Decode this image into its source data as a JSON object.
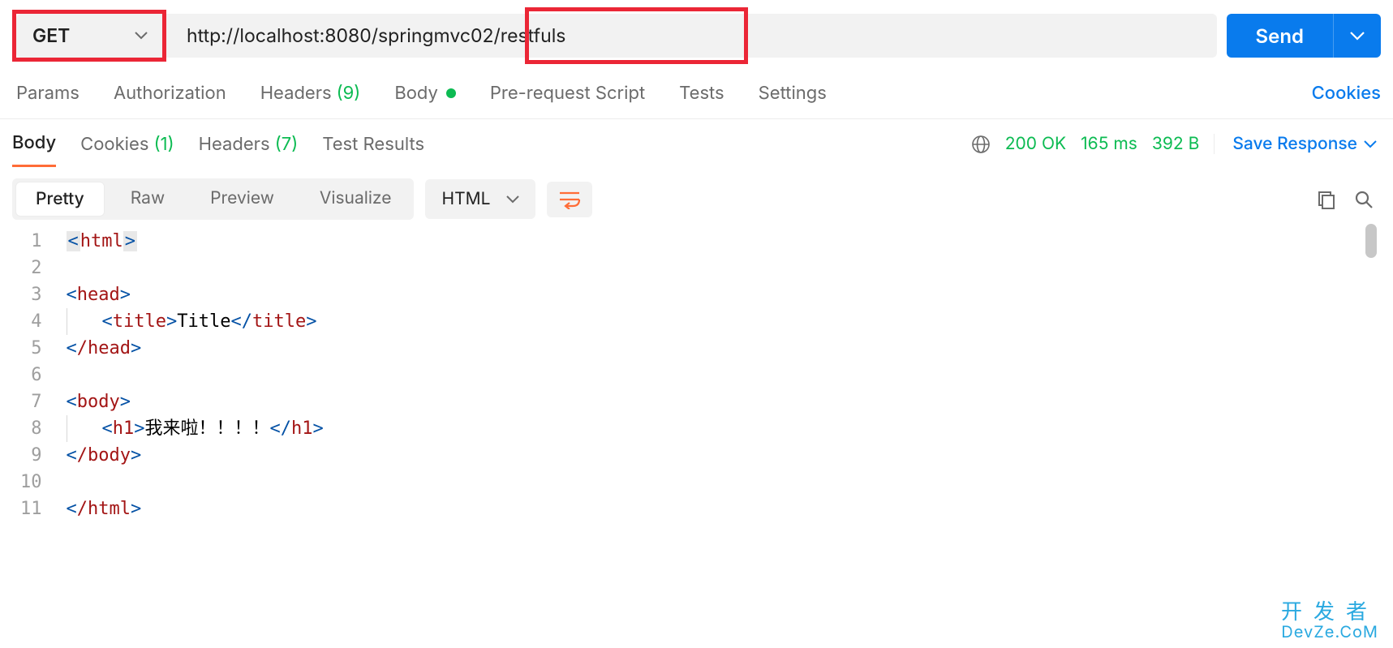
{
  "request": {
    "method": "GET",
    "url": "http://localhost:8080/springmvc02/restfuls",
    "send_label": "Send",
    "tabs": {
      "params": "Params",
      "auth": "Authorization",
      "headers_label": "Headers",
      "headers_count": "(9)",
      "body": "Body",
      "prereq": "Pre-request Script",
      "tests": "Tests",
      "settings": "Settings"
    },
    "cookies_link": "Cookies"
  },
  "response": {
    "tabs": {
      "body": "Body",
      "cookies_label": "Cookies",
      "cookies_count": "(1)",
      "headers_label": "Headers",
      "headers_count": "(7)",
      "test_results": "Test Results"
    },
    "status_code": "200 OK",
    "time": "165 ms",
    "size": "392 B",
    "save_label": "Save Response"
  },
  "view": {
    "pretty": "Pretty",
    "raw": "Raw",
    "preview": "Preview",
    "visualize": "Visualize",
    "lang": "HTML"
  },
  "code": {
    "lines": [
      "1",
      "2",
      "3",
      "4",
      "5",
      "6",
      "7",
      "8",
      "9",
      "10",
      "11"
    ],
    "l1_tag": "html",
    "l3_tag": "head",
    "l4_tag": "title",
    "l4_text": "Title",
    "l5_tag": "/head",
    "l7_tag": "body",
    "l8_tag": "h1",
    "l8_text": "我来啦！！！！",
    "l9_tag": "/body",
    "l11_tag": "/html"
  },
  "watermark": {
    "line1": "开发者",
    "line2": "DevZe.CoM"
  }
}
